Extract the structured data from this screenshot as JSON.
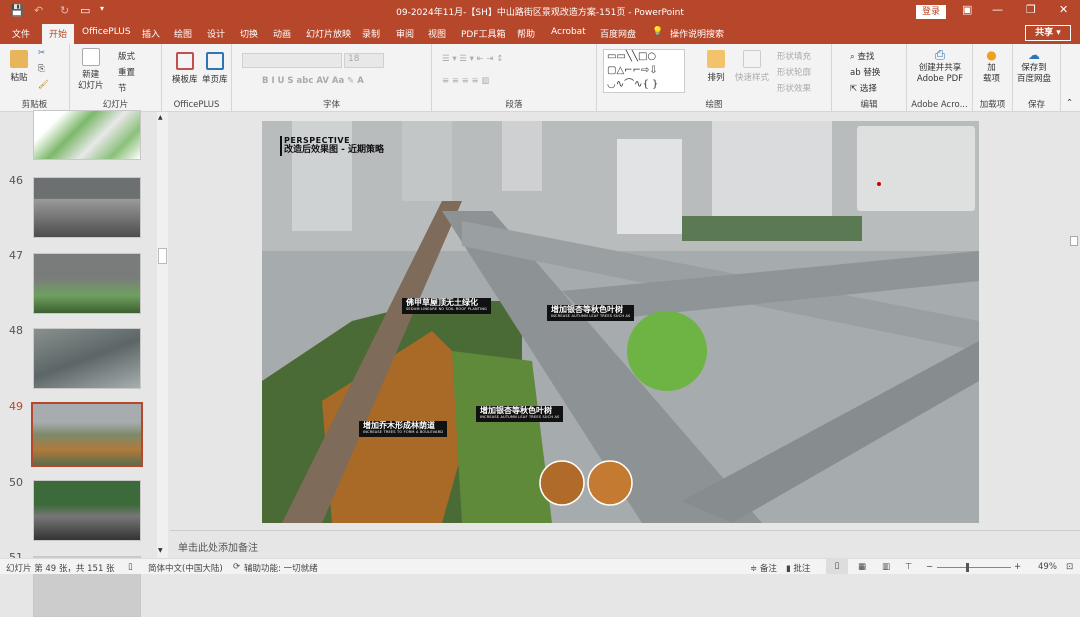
{
  "window": {
    "title": "09-2024年11月-【SH】中山路街区景观改造方案-151页  -  PowerPoint",
    "login": "登录",
    "share": "共享"
  },
  "tabs": [
    "文件",
    "开始",
    "OfficePLUS",
    "插入",
    "绘图",
    "设计",
    "切换",
    "动画",
    "幻灯片放映",
    "录制",
    "审阅",
    "视图",
    "PDF工具箱",
    "帮助",
    "Acrobat",
    "百度网盘"
  ],
  "active_tab": "开始",
  "tell_me": "操作说明搜索",
  "ribbon": {
    "clipboard": {
      "label": "剪贴板",
      "paste": "粘贴"
    },
    "slides": {
      "label": "幻灯片",
      "new_slide": "新建\n幻灯片",
      "layout": "版式",
      "reset": "重置",
      "section": "节"
    },
    "officeplus": {
      "label": "OfficePLUS",
      "template": "模板库",
      "single": "单页库"
    },
    "font": {
      "label": "字体",
      "size": "18"
    },
    "paragraph": {
      "label": "段落"
    },
    "drawing": {
      "label": "绘图",
      "arrange": "排列",
      "quick_styles": "快速样式",
      "fill": "形状填充",
      "outline": "形状轮廓",
      "effects": "形状效果"
    },
    "editing": {
      "label": "编辑",
      "find": "查找",
      "replace": "替换",
      "select": "选择"
    },
    "adobe": {
      "label": "Adobe Acro...",
      "create": "创建并共享\nAdobe PDF"
    },
    "addins": {
      "label": "加载项",
      "btn": "加\n载项"
    },
    "save": {
      "label": "保存",
      "btn": "保存到\n百度网盘"
    }
  },
  "thumbnails": [
    {
      "num": "46"
    },
    {
      "num": "47"
    },
    {
      "num": "48"
    },
    {
      "num": "49",
      "selected": true
    },
    {
      "num": "50"
    },
    {
      "num": "51"
    }
  ],
  "slide": {
    "heading": "PERSPECTIVE",
    "subheading": "改造后效果图 - 近期策略",
    "callouts": [
      {
        "cn": "佛甲草屋顶无土绿化",
        "en": "SEDUM LINEARE NO SOIL ROOF PLANTING"
      },
      {
        "cn": "增加银杏等秋色叶树",
        "en": "INCREASE AUTUMN LEAF TREES SUCH AS"
      },
      {
        "cn": "增加银杏等秋色叶树",
        "en": "INCREASE AUTUMN LEAF TREES SUCH AS"
      },
      {
        "cn": "增加乔木形成林荫道",
        "en": "INCREASE TREES TO FORM A BOULEVARD"
      }
    ]
  },
  "notes_placeholder": "单击此处添加备注",
  "status": {
    "slide_info": "幻灯片 第 49 张，共 151 张",
    "language": "简体中文(中国大陆)",
    "accessibility": "辅助功能: 一切就绪",
    "notes": "备注",
    "comments": "批注",
    "zoom": "49%",
    "zoom_level": 49
  },
  "colors": {
    "accent": "#b7472a"
  }
}
